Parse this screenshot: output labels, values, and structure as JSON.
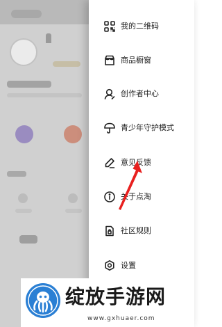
{
  "menu": {
    "items": [
      {
        "label": "我的二维码",
        "icon": "qrcode-icon"
      },
      {
        "label": "商品橱窗",
        "icon": "shop-window-icon"
      },
      {
        "label": "创作者中心",
        "icon": "creator-icon"
      },
      {
        "label": "青少年守护模式",
        "icon": "umbrella-icon"
      },
      {
        "label": "意见反馈",
        "icon": "pencil-icon"
      },
      {
        "label": "关于点淘",
        "icon": "info-icon"
      },
      {
        "label": "社区规则",
        "icon": "rules-icon"
      },
      {
        "label": "设置",
        "icon": "gear-icon"
      }
    ]
  },
  "annotation": {
    "icon": "red-arrow-icon",
    "color": "#e8201f"
  },
  "watermark": {
    "title": "绽放手游网",
    "url": "www.gxhuaer.com",
    "logo_icon": "octopus-logo-icon",
    "logo_color": "#2a7fd4"
  }
}
